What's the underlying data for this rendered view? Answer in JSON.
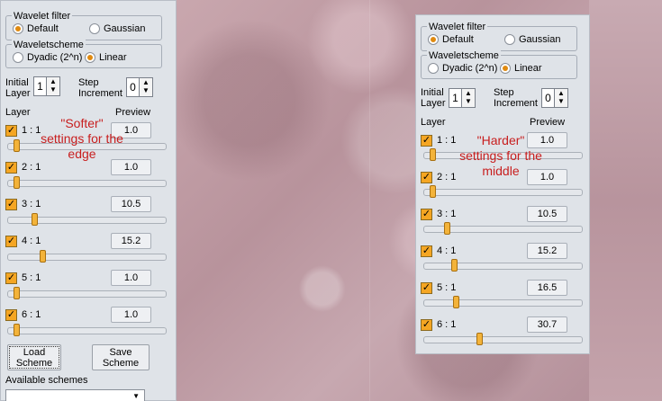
{
  "wavelet_filter": {
    "title": "Wavelet filter",
    "default": "Default",
    "gaussian": "Gaussian",
    "selected": "Default"
  },
  "wavelet_scheme": {
    "title": "Waveletscheme",
    "dyadic": "Dyadic (2^n)",
    "linear": "Linear",
    "selected": "Linear"
  },
  "initial_layer": {
    "label_line1": "Initial",
    "label_line2": "Layer",
    "value": "1"
  },
  "step_increment": {
    "label_line1": "Step",
    "label_line2": "Increment",
    "value": "0"
  },
  "layer_header": "Layer",
  "preview_header": "Preview",
  "left_panel": {
    "layers": [
      {
        "label": "1 : 1",
        "checked": true,
        "value": "1.0",
        "slider": 0.0
      },
      {
        "label": "2 : 1",
        "checked": true,
        "value": "1.0",
        "slider": 0.0
      },
      {
        "label": "3 : 1",
        "checked": true,
        "value": "10.5",
        "slider": 0.12
      },
      {
        "label": "4 : 1",
        "checked": true,
        "value": "15.2",
        "slider": 0.18
      },
      {
        "label": "5 : 1",
        "checked": true,
        "value": "1.0",
        "slider": 0.0
      },
      {
        "label": "6 : 1",
        "checked": true,
        "value": "1.0",
        "slider": 0.0
      }
    ],
    "load_button": {
      "line1": "Load",
      "line2": "Scheme"
    },
    "save_button": {
      "line1": "Save",
      "line2": "Scheme"
    },
    "available_schemes": "Available schemes"
  },
  "right_panel": {
    "layers": [
      {
        "label": "1 : 1",
        "checked": true,
        "value": "1.0",
        "slider": 0.0
      },
      {
        "label": "2 : 1",
        "checked": true,
        "value": "1.0",
        "slider": 0.0
      },
      {
        "label": "3 : 1",
        "checked": true,
        "value": "10.5",
        "slider": 0.1
      },
      {
        "label": "4 : 1",
        "checked": true,
        "value": "15.2",
        "slider": 0.15
      },
      {
        "label": "5 : 1",
        "checked": true,
        "value": "16.5",
        "slider": 0.16
      },
      {
        "label": "6 : 1",
        "checked": true,
        "value": "30.7",
        "slider": 0.32
      }
    ]
  },
  "annotations": {
    "left": [
      "\"Softer\"",
      "settings for the",
      "edge"
    ],
    "right": [
      "\"Harder\"",
      "settings for the",
      "middle"
    ]
  },
  "colors": {
    "annotation": "#c81e1e",
    "checkbox": "#f5a623",
    "radio_selected": "#e08a10"
  },
  "icons": {
    "checkbox": "check-icon",
    "spin_up": "arrow-up-icon",
    "spin_down": "arrow-down-icon",
    "dropdown": "chevron-down-icon"
  }
}
